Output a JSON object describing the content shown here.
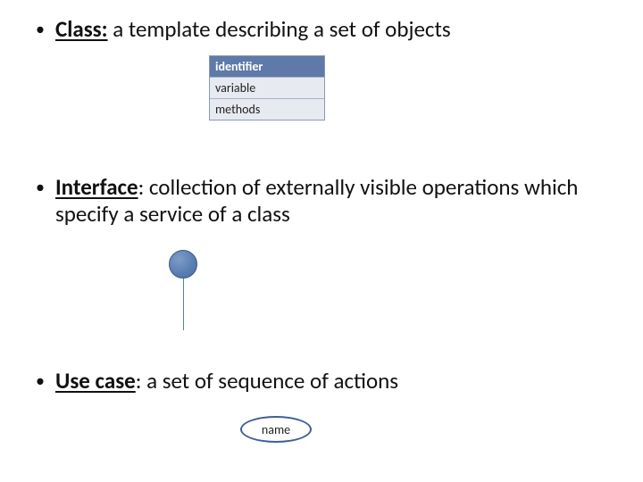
{
  "bullets": {
    "class": {
      "label": "Class:",
      "desc": " a template describing a set of objects"
    },
    "interface": {
      "label": "Interface",
      "desc": ": collection of externally visible operations which specify a service of a class"
    },
    "usecase": {
      "label": "Use case",
      "desc": ": a set of sequence of actions"
    }
  },
  "uml": {
    "head": "identifier",
    "row1": "variable",
    "row2": "methods"
  },
  "usecase_name": "name"
}
